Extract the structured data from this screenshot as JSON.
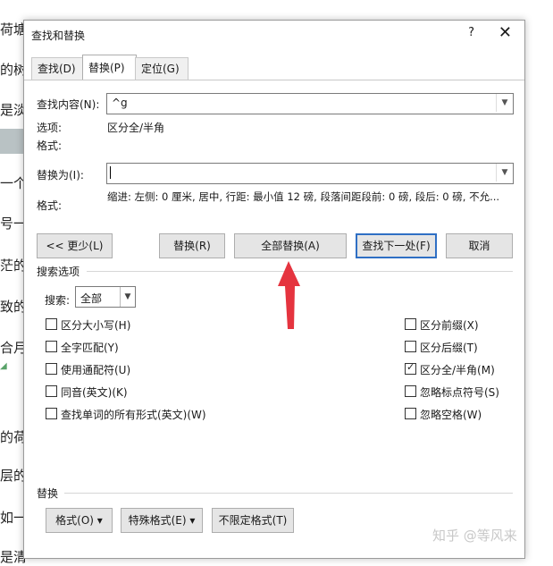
{
  "background_doc": {
    "lines": [
      "荷塘",
      "的树",
      "是淡",
      "一个",
      "号一",
      "茫的",
      "致的",
      "合月",
      "的荷",
      "层的",
      "如一",
      "是清"
    ]
  },
  "dialog": {
    "title": "查找和替换",
    "help_label": "?",
    "close_label": "✕",
    "tabs": [
      {
        "label": "查找(D)"
      },
      {
        "label": "替换(P)"
      },
      {
        "label": "定位(G)"
      }
    ],
    "find": {
      "label": "查找内容(N):",
      "value": "^g",
      "options_label": "选项:",
      "options_value": "区分全/半角",
      "format_label": "格式:"
    },
    "replace": {
      "label": "替换为(I):",
      "value": "",
      "format_label": "格式:",
      "format_value": "缩进: 左侧:  0 厘米, 居中, 行距: 最小值 12 磅, 段落间距段前: 0 磅, 段后: 0 磅, 不允..."
    },
    "buttons": {
      "less": "<< 更少(L)",
      "replace": "替换(R)",
      "replace_all": "全部替换(A)",
      "find_next": "查找下一处(F)",
      "cancel": "取消"
    },
    "search_options": {
      "section_title": "搜索选项",
      "search_label": "搜索:",
      "search_value": "全部",
      "left_checks": [
        {
          "label": "区分大小写(H)",
          "checked": false
        },
        {
          "label": "全字匹配(Y)",
          "checked": false
        },
        {
          "label": "使用通配符(U)",
          "checked": false
        },
        {
          "label": "同音(英文)(K)",
          "checked": false
        },
        {
          "label": "查找单词的所有形式(英文)(W)",
          "checked": false
        }
      ],
      "right_checks": [
        {
          "label": "区分前缀(X)",
          "checked": false
        },
        {
          "label": "区分后缀(T)",
          "checked": false
        },
        {
          "label": "区分全/半角(M)",
          "checked": true
        },
        {
          "label": "忽略标点符号(S)",
          "checked": false
        },
        {
          "label": "忽略空格(W)",
          "checked": false
        }
      ]
    },
    "replace_section": {
      "title": "替换",
      "format_btn": "格式(O) ▾",
      "special_btn": "特殊格式(E) ▾",
      "no_format_btn": "不限定格式(T)"
    }
  },
  "watermark": "知乎 @等风来",
  "colors": {
    "arrow": "#e5343f",
    "default_button_border": "#2f6fc4"
  }
}
